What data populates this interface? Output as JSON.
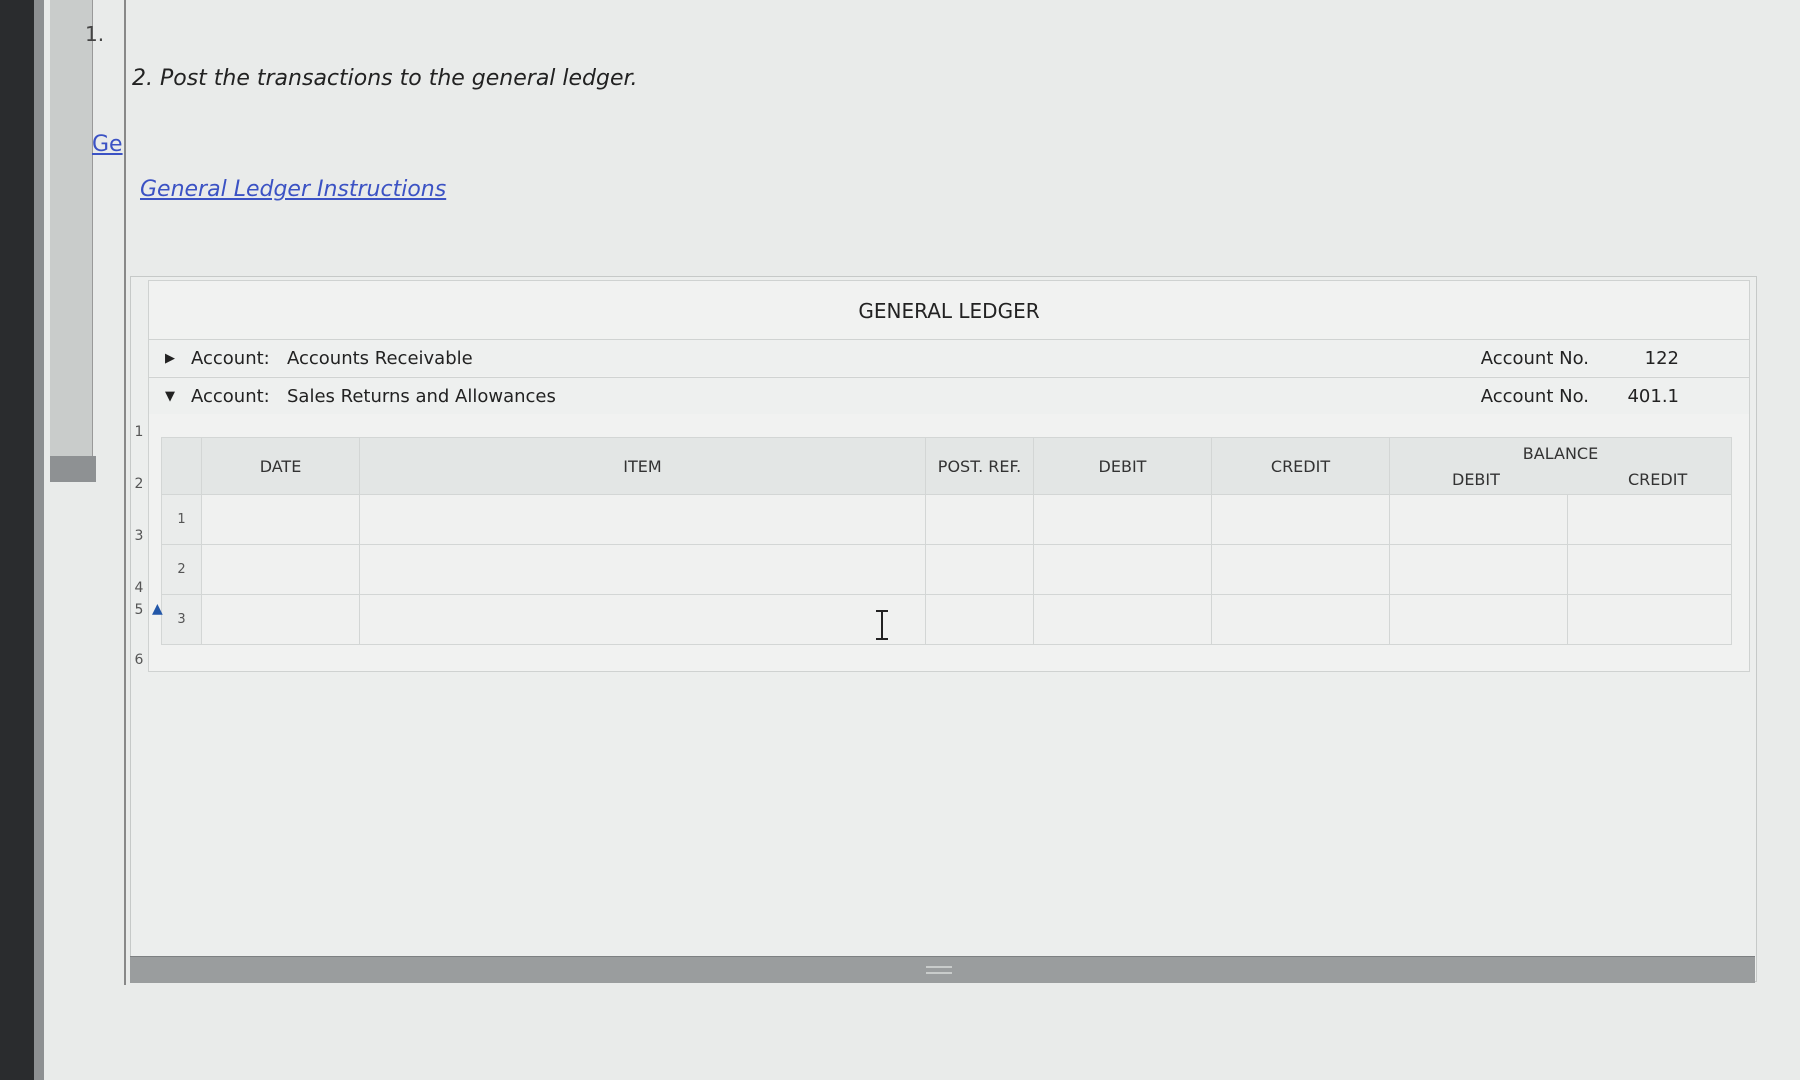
{
  "question": {
    "number": "1.",
    "instruction": "2. Post the transactions to the general ledger.",
    "tab_link": "Ge",
    "instructions_link": "General Ledger Instructions"
  },
  "ledger": {
    "title": "GENERAL LEDGER",
    "accounts": [
      {
        "label": "Account:",
        "name": "Accounts Receivable",
        "no_label": "Account No.",
        "no": "122",
        "expanded": false
      },
      {
        "label": "Account:",
        "name": "Sales Returns and Allowances",
        "no_label": "Account No.",
        "no": "401.1",
        "expanded": true
      }
    ],
    "columns": {
      "date": "DATE",
      "item": "ITEM",
      "post_ref": "POST. REF.",
      "debit": "DEBIT",
      "credit": "CREDIT",
      "balance": "BALANCE",
      "balance_debit": "DEBIT",
      "balance_credit": "CREDIT"
    },
    "rows": [
      "1",
      "2",
      "3"
    ]
  },
  "outer_row_numbers": [
    "1",
    "2",
    "3",
    "4",
    "5",
    "6"
  ]
}
